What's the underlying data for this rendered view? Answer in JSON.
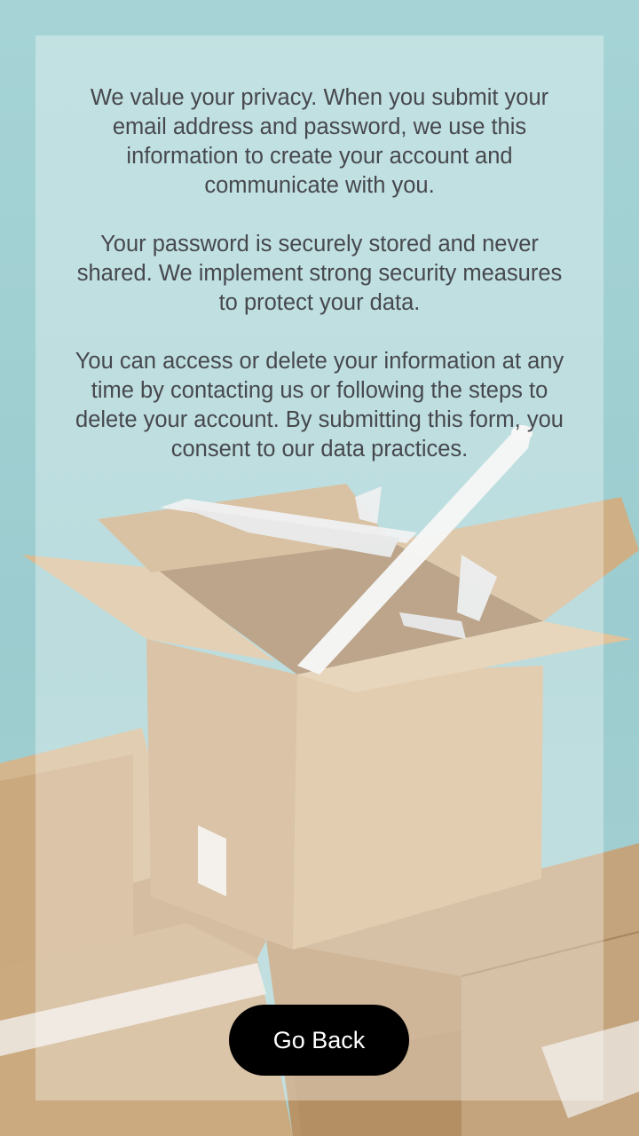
{
  "privacy": {
    "paragraph_1": "We value your privacy. When you submit your email address and password, we use this information to create your account and communicate with you.",
    "paragraph_2": "Your password is securely stored and never shared. We implement strong security measures to protect your data.",
    "paragraph_3": "You can access or delete your information at any time by contacting us or following the steps to delete your account. By submitting this form, you consent to our data practices."
  },
  "actions": {
    "go_back_label": "Go Back"
  },
  "colors": {
    "background": "#9fcfd2",
    "text": "#46484d",
    "button_bg": "#000000",
    "button_text": "#ffffff"
  },
  "background_image": {
    "icon": "cardboard-boxes-with-toy-airplane-photo"
  }
}
